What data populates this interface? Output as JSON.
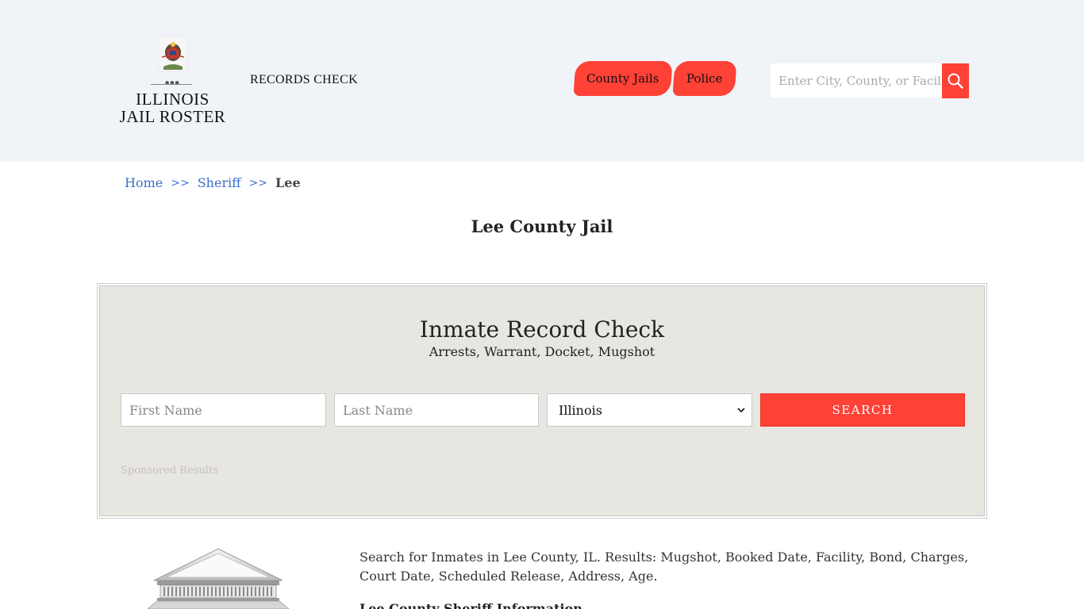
{
  "header": {
    "logo_text_line1": "ILLINOIS",
    "logo_text_line2": "JAIL ROSTER",
    "records_check": "RECORDS CHECK",
    "nav": [
      {
        "label": "County Jails"
      },
      {
        "label": "Police"
      }
    ],
    "search_placeholder": "Enter City, County, or Facil"
  },
  "breadcrumb": {
    "home": "Home",
    "sep": ">>",
    "sheriff": "Sheriff",
    "current": "Lee"
  },
  "page_title": "Lee County Jail",
  "record_check": {
    "title": "Inmate Record Check",
    "subtitle": "Arrests, Warrant, Docket, Mugshot",
    "first_name_placeholder": "First Name",
    "last_name_placeholder": "Last Name",
    "state_selected": "Illinois",
    "submit_label": "SEARCH",
    "sponsored": "Sponsored Results"
  },
  "content": {
    "description": "Search for Inmates in Lee County, IL. Results: Mugshot, Booked Date, Facility, Bond, Charges, Court Date, Scheduled Release, Address, Age.",
    "subheading": "Lee County Sheriff Information"
  },
  "colors": {
    "accent": "#ff4136",
    "header_bg": "#f0f4f8",
    "panel_bg": "#e8e6e1",
    "link": "#3a6fc9"
  },
  "icons": {
    "search": "search-icon",
    "select": "chevron-down-icon",
    "logo": "state-seal-icon",
    "building": "courthouse-icon"
  }
}
